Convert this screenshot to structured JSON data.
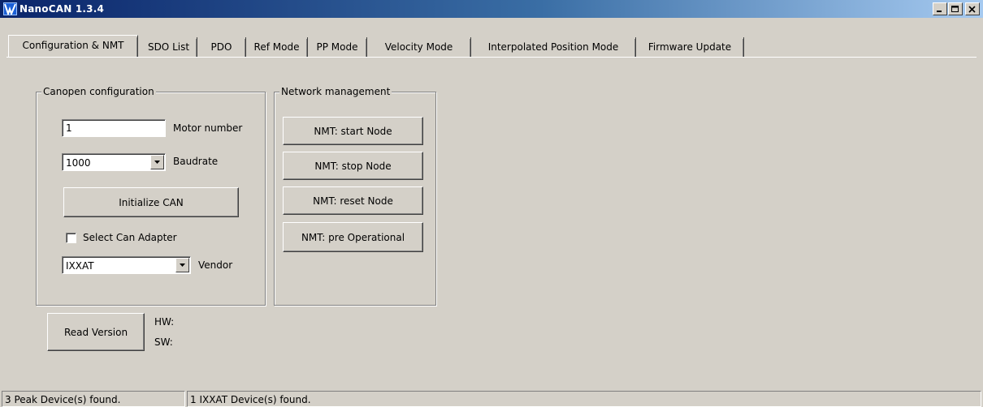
{
  "window": {
    "title": "NanoCAN 1.3.4"
  },
  "tabs": [
    {
      "label": "Configuration & NMT",
      "active": true
    },
    {
      "label": "SDO List"
    },
    {
      "label": "PDO"
    },
    {
      "label": "Ref Mode"
    },
    {
      "label": "PP Mode"
    },
    {
      "label": "Velocity Mode"
    },
    {
      "label": "Interpolated Position Mode"
    },
    {
      "label": "Firmware Update"
    }
  ],
  "canopen": {
    "group_label": "Canopen configuration",
    "motor_number_value": "1",
    "motor_number_label": "Motor number",
    "baudrate_value": "1000",
    "baudrate_label": "Baudrate",
    "initialize_label": "Initialize CAN",
    "select_adapter_label": "Select Can Adapter",
    "select_adapter_checked": false,
    "vendor_value": "IXXAT",
    "vendor_label": "Vendor"
  },
  "network": {
    "group_label": "Network management",
    "buttons": [
      "NMT: start Node",
      "NMT: stop Node",
      "NMT: reset Node",
      "NMT: pre Operational"
    ]
  },
  "version": {
    "read_label": "Read Version",
    "hw_label": "HW:",
    "sw_label": "SW:"
  },
  "status": {
    "panel1": "3 Peak Device(s) found.",
    "panel2": "1 IXXAT Device(s) found."
  },
  "icons": {
    "app": "nanocan-logo-icon",
    "minimize": "minimize-icon",
    "maximize": "maximize-icon",
    "close": "close-icon",
    "dropdown": "chevron-down-icon"
  },
  "colors": {
    "face": "#d4d0c8",
    "titlebar_start": "#0a246a",
    "titlebar_end": "#a6caf0"
  }
}
